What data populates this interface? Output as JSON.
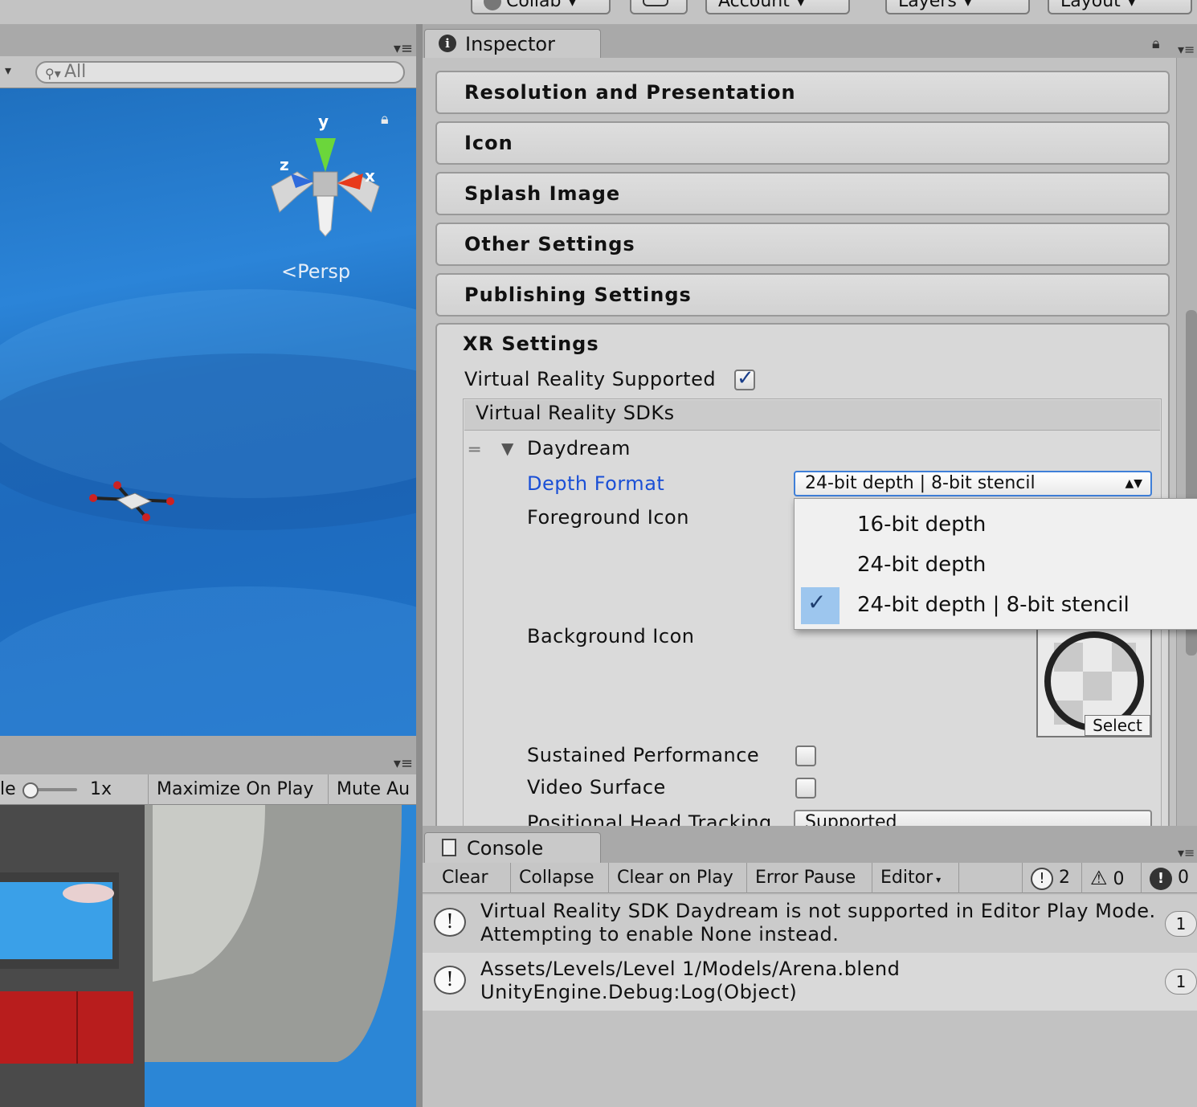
{
  "toolbar": {
    "collab": "Collab",
    "account": "Account",
    "layers": "Layers",
    "layout": "Layout"
  },
  "scene": {
    "search_value": "All",
    "projection_label": "Persp",
    "axis_y": "y",
    "axis_x": "x",
    "axis_z": "z"
  },
  "game": {
    "scale_label_partial": "le",
    "scale_value": "1x",
    "maximize_on_play": "Maximize On Play",
    "mute_audio_partial": "Mute Au"
  },
  "inspector": {
    "tab_title": "Inspector",
    "sections": [
      "Resolution and Presentation",
      "Icon",
      "Splash Image",
      "Other Settings",
      "Publishing Settings"
    ],
    "xr": {
      "title": "XR Settings",
      "vr_supported_label": "Virtual Reality Supported",
      "vr_supported": true,
      "sdk_list_header": "Virtual Reality SDKs",
      "sdk_name": "Daydream",
      "depth_format_label": "Depth Format",
      "depth_format_value": "24-bit depth | 8-bit stencil",
      "foreground_icon_label": "Foreground Icon",
      "background_icon_label": "Background Icon",
      "select_label": "Select",
      "sustained_performance_label": "Sustained Performance",
      "sustained_performance": false,
      "video_surface_label": "Video Surface",
      "video_surface": false,
      "positional_head_tracking_label": "Positional Head Tracking",
      "positional_head_tracking_value": "Supported"
    },
    "depth_popup": {
      "options": [
        "16-bit depth",
        "24-bit depth",
        "24-bit depth | 8-bit stencil"
      ],
      "selected": "24-bit depth | 8-bit stencil"
    }
  },
  "console": {
    "tab_title": "Console",
    "buttons": {
      "clear": "Clear",
      "collapse": "Collapse",
      "clear_on_play": "Clear on Play",
      "error_pause": "Error Pause",
      "editor": "Editor"
    },
    "counts": {
      "info": "2",
      "warning": "0",
      "error": "0"
    },
    "logs": [
      {
        "line1": "Virtual Reality SDK Daydream is not supported in Editor Play Mode.",
        "line2": "Attempting to enable None instead.",
        "count": "1"
      },
      {
        "line1": "Assets/Levels/Level 1/Models/Arena.blend",
        "line2": "UnityEngine.Debug:Log(Object)",
        "count": "1"
      }
    ]
  },
  "colors": {
    "accent_blue": "#3f7fd8",
    "scene_sky": "#2b84d8",
    "selection_highlight": "#9dc6ee",
    "label_active": "#1a4fd6"
  }
}
